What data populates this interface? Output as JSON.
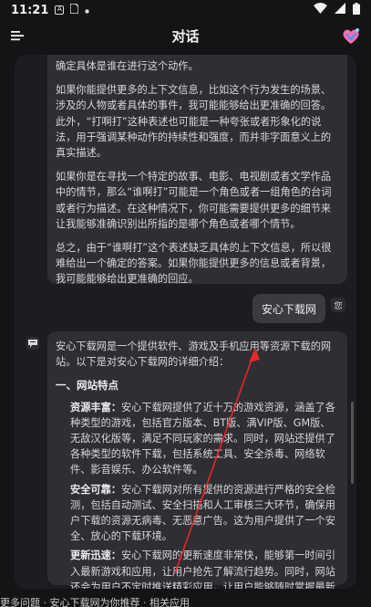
{
  "status": {
    "time": "11:21",
    "a_icon": "A"
  },
  "header": {
    "title": "对话",
    "menu_icon": "hamburger-menu-icon",
    "logo_icon": "app-logo-icon"
  },
  "chat": {
    "msg1": {
      "p0": "确定具体是谁在进行这个动作。",
      "p1": "如果你能提供更多的上下文信息，比如这个行为发生的场景、涉及的人物或者具体的事件，我可能能够给出更准确的回答。此外，“打啊打”这种表述也可能是一种夸张或者形象化的说法，用于强调某种动作的持续性和强度，而并非字面意义上的真实描述。",
      "p2": "如果你是在寻找一个特定的故事、电影、电视剧或者文学作品中的情节，那么“谁啊打”可能是一个角色或者一组角色的台词或者行为描述。在这种情况下，你可能需要提供更多的细节来让我能够准确识别出所指的是哪个角色或者哪个情节。",
      "p3": "总之，由于“谁啊打”这个表述缺乏具体的上下文信息，所以很难给出一个确定的答案。如果你能提供更多的信息或者背景，我可能能够给出更准确的回应。"
    },
    "user_message": "安心下载网",
    "user_avatar_label": "您",
    "msg2": {
      "intro": "安心下载网是一个提供软件、游戏及手机应用等资源下载的网站。以下是对安心下载网的详细介绍：",
      "section_title": "一、网站特点",
      "items": [
        {
          "label": "资源丰富：",
          "text": "安心下载网提供了近十万的游戏资源，涵盖了各种类型的游戏，包括官方版本、BT版、满VIP版、GM版、无敌汉化版等，满足不同玩家的需求。同时，网站还提供了各种类型的软件下载，包括系统工具、安全杀毒、网络软件、影音娱乐、办公软件等。"
        },
        {
          "label": "安全可靠：",
          "text": "安心下载网对所有提供的资源进行严格的安全检测，包括自动测试、安全扫描和人工审核三大环节，确保用户下载的资源无病毒、无恶意广告。这为用户提供了一个安全、放心的下载环境。"
        },
        {
          "label": "更新迅速：",
          "text": "安心下载网的更新速度非常快，能够第一时间引入最新游戏和应用，让用户抢先了解流行趋势。同时，网站还会为用户不定时推送精彩应用，让用户能够随时掌握最新资源。"
        }
      ]
    }
  },
  "bottom_text": "更多问题 · 安心下载网为你推荐 · 相关应用"
}
